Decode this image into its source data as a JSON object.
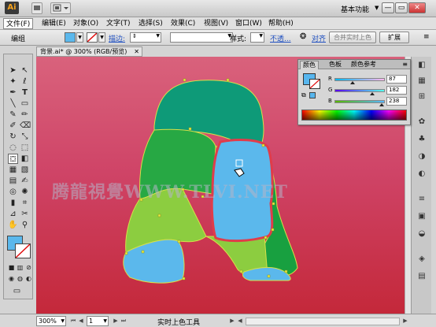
{
  "app": {
    "logo": "Ai"
  },
  "workspace": {
    "label": "基本功能"
  },
  "menu": [
    "文件(F)",
    "编辑(E)",
    "对象(O)",
    "文字(T)",
    "选择(S)",
    "效果(C)",
    "视图(V)",
    "窗口(W)",
    "帮助(H)"
  ],
  "control": {
    "group_label": "编组",
    "stroke_label": "描边:",
    "style_label": "样式:",
    "opacity_link": "不透...",
    "align_link": "对齐",
    "live_paint_merge": "合并实时上色",
    "expand_button": "扩展",
    "fill_color": "#5bb8ec"
  },
  "document": {
    "tab_title": "背景.ai* @ 300% (RGB/预览)"
  },
  "watermark": "腾龍視覺WWW.TLVI.NET",
  "color_panel": {
    "tabs": [
      "颜色",
      "色板",
      "颜色参考"
    ],
    "r": {
      "label": "R",
      "value": "87"
    },
    "g": {
      "label": "G",
      "value": "182"
    },
    "b": {
      "label": "B",
      "value": "238"
    },
    "current_fill": "#57b6ee"
  },
  "status": {
    "zoom": "300%",
    "page": "1",
    "tool": "实时上色工具"
  }
}
